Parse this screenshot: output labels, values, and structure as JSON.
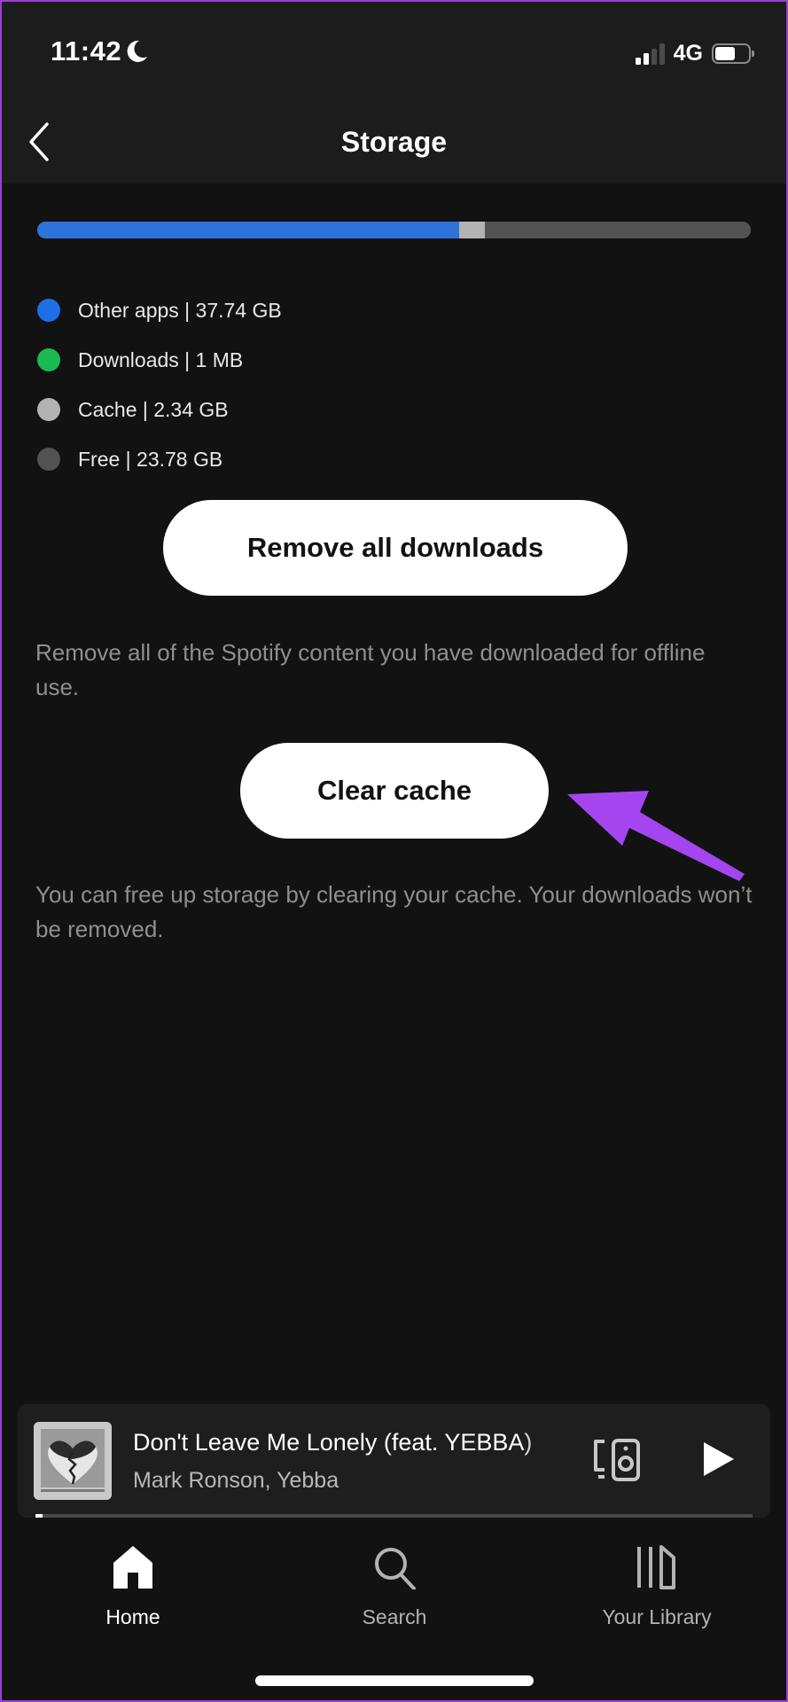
{
  "status_bar": {
    "time": "11:42",
    "focus_icon": "moon-icon",
    "signal_bars_active": 2,
    "signal_bars_total": 4,
    "network": "4G",
    "battery_level": 0.6
  },
  "header": {
    "back_icon": "chevron-left-icon",
    "title": "Storage"
  },
  "storage": {
    "bar_segments": [
      {
        "name": "Other apps",
        "gb": 37.74,
        "color": "#2d73d9"
      },
      {
        "name": "Downloads",
        "gb": 0.001,
        "color": "#1db954"
      },
      {
        "name": "Cache",
        "gb": 2.34,
        "color": "#b3b3b3"
      },
      {
        "name": "Free",
        "gb": 23.78,
        "color": "#535353"
      }
    ],
    "legend": [
      {
        "label": "Other apps | 37.74 GB",
        "color": "#1e6ee8"
      },
      {
        "label": "Downloads | 1 MB",
        "color": "#1db954"
      },
      {
        "label": "Cache | 2.34 GB",
        "color": "#b3b3b3"
      },
      {
        "label": "Free | 23.78 GB",
        "color": "#535353"
      }
    ]
  },
  "actions": {
    "remove_downloads_label": "Remove all downloads",
    "remove_downloads_desc": "Remove all of the Spotify content you have downloaded for offline use.",
    "clear_cache_label": "Clear cache",
    "clear_cache_desc": "You can free up storage by clearing your cache. Your downloads won’t be removed."
  },
  "annotation": {
    "arrow_color": "#a445f0",
    "points_to": "Clear cache"
  },
  "now_playing": {
    "title": "Don't Leave Me Lonely (feat. YEBBA)",
    "artist": "Mark Ronson, Yebba",
    "progress": 0.01,
    "devices_icon": "devices-speaker-icon",
    "play_icon": "play-icon"
  },
  "tabs": [
    {
      "label": "Home",
      "icon": "home-icon",
      "active": true
    },
    {
      "label": "Search",
      "icon": "search-icon",
      "active": false
    },
    {
      "label": "Your Library",
      "icon": "library-icon",
      "active": false
    }
  ]
}
